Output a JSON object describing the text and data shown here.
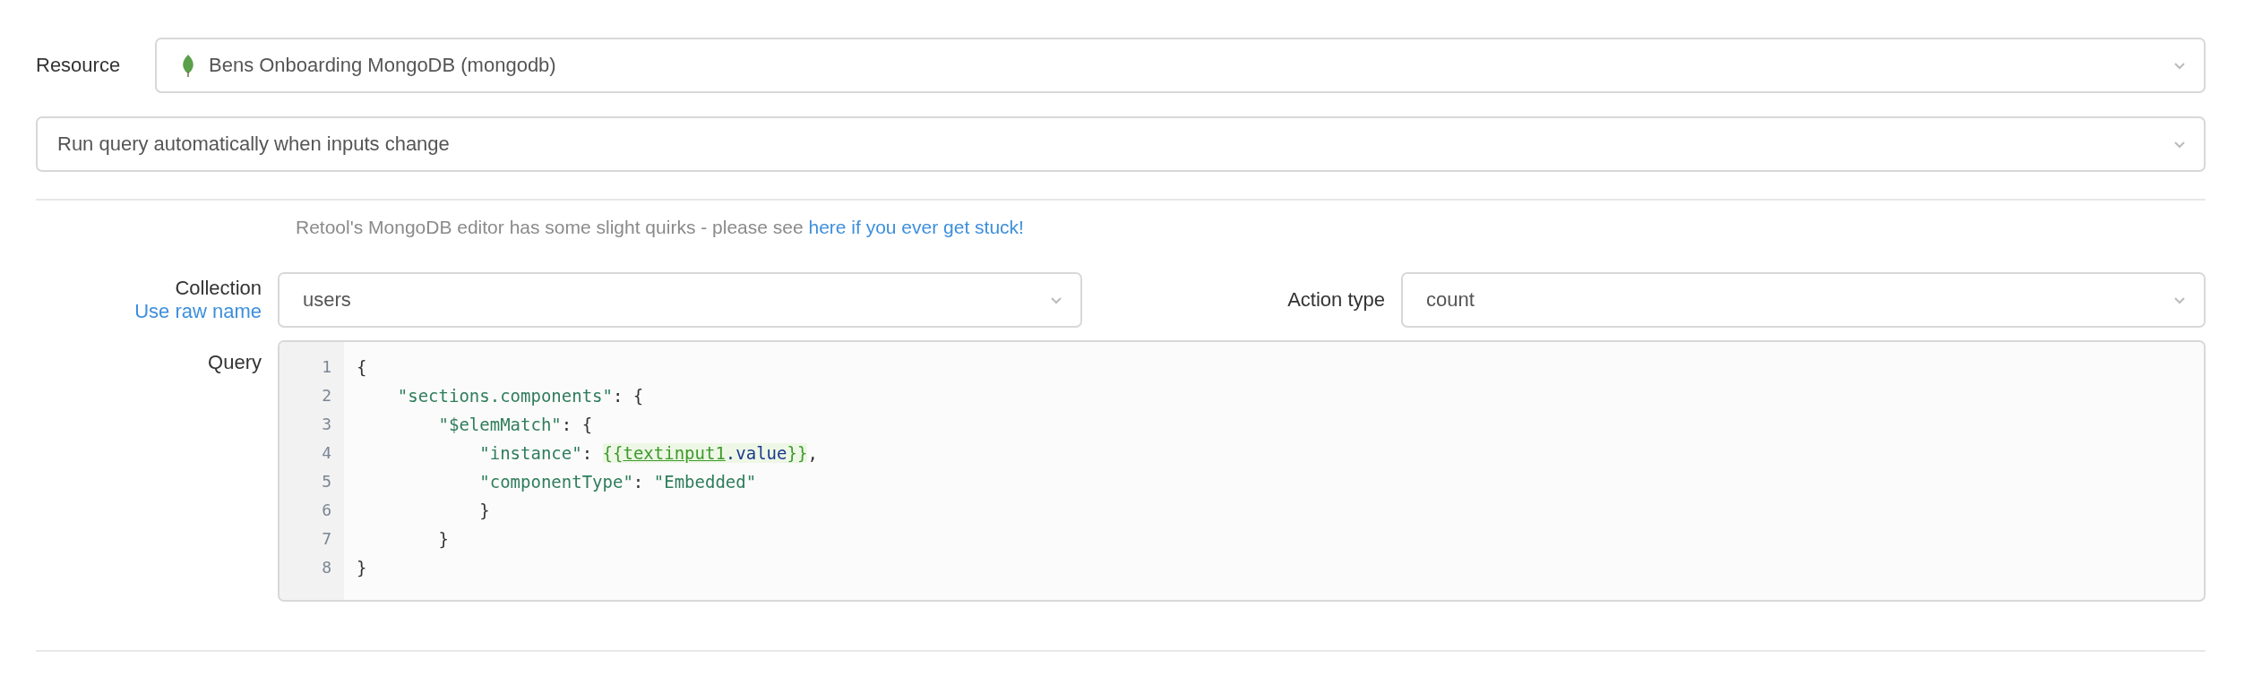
{
  "resource": {
    "label": "Resource",
    "value": "Bens Onboarding MongoDB (mongodb)"
  },
  "trigger": {
    "value": "Run query automatically when inputs change"
  },
  "note": {
    "text": "Retool's MongoDB editor has some slight quirks - please see ",
    "link": "here if you ever get stuck!"
  },
  "collection": {
    "label": "Collection",
    "link": "Use raw name",
    "value": "users"
  },
  "action_type": {
    "label": "Action type",
    "value": "count"
  },
  "query": {
    "label": "Query",
    "lines": [
      {
        "number": "1",
        "tokens": [
          {
            "kind": "plain",
            "text": "{"
          }
        ]
      },
      {
        "number": "2",
        "tokens": [
          {
            "kind": "key",
            "text": "    \"sections.components\""
          },
          {
            "kind": "plain",
            "text": ": {"
          }
        ]
      },
      {
        "number": "3",
        "tokens": [
          {
            "kind": "key",
            "text": "        \"$elemMatch\""
          },
          {
            "kind": "plain",
            "text": ": {"
          }
        ]
      },
      {
        "number": "4",
        "tokens": [
          {
            "kind": "key",
            "text": "            \"instance\""
          },
          {
            "kind": "plain",
            "text": ": "
          },
          {
            "kind": "brace",
            "text": "{{"
          },
          {
            "kind": "var",
            "text": "textinput1"
          },
          {
            "kind": "prop",
            "text": ".value"
          },
          {
            "kind": "brace",
            "text": "}}"
          },
          {
            "kind": "plain",
            "text": ","
          }
        ]
      },
      {
        "number": "5",
        "tokens": [
          {
            "kind": "key",
            "text": "            \"componentType\""
          },
          {
            "kind": "plain",
            "text": ": "
          },
          {
            "kind": "string",
            "text": "\"Embedded\""
          }
        ]
      },
      {
        "number": "6",
        "tokens": [
          {
            "kind": "plain",
            "text": "            }"
          }
        ]
      },
      {
        "number": "7",
        "tokens": [
          {
            "kind": "plain",
            "text": "        }"
          }
        ]
      },
      {
        "number": "8",
        "tokens": [
          {
            "kind": "plain",
            "text": "}"
          }
        ]
      }
    ]
  }
}
